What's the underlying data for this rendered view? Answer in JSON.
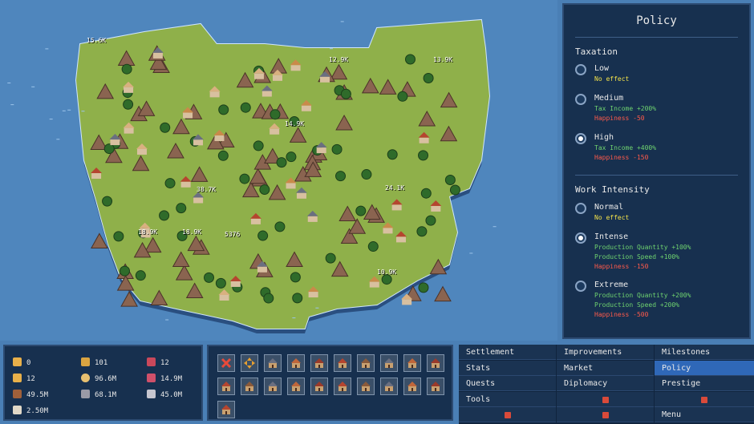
{
  "policy": {
    "title": "Policy",
    "taxation": {
      "title": "Taxation",
      "options": [
        {
          "name": "Low",
          "effects": [
            {
              "text": "No effect",
              "kind": "neutral"
            }
          ],
          "selected": false
        },
        {
          "name": "Medium",
          "effects": [
            {
              "text": "Tax Income +200%",
              "kind": "pos"
            },
            {
              "text": "Happiness -50",
              "kind": "neg"
            }
          ],
          "selected": false
        },
        {
          "name": "High",
          "effects": [
            {
              "text": "Tax Income +400%",
              "kind": "pos"
            },
            {
              "text": "Happiness -150",
              "kind": "neg"
            }
          ],
          "selected": true
        }
      ]
    },
    "work": {
      "title": "Work Intensity",
      "options": [
        {
          "name": "Normal",
          "effects": [
            {
              "text": "No effect",
              "kind": "neutral"
            }
          ],
          "selected": false
        },
        {
          "name": "Intense",
          "effects": [
            {
              "text": "Production Quantity +100%",
              "kind": "pos"
            },
            {
              "text": "Production Speed +100%",
              "kind": "pos"
            },
            {
              "text": "Happiness -150",
              "kind": "neg"
            }
          ],
          "selected": true
        },
        {
          "name": "Extreme",
          "effects": [
            {
              "text": "Production Quantity +200%",
              "kind": "pos"
            },
            {
              "text": "Production Speed +200%",
              "kind": "pos"
            },
            {
              "text": "Happiness -500",
              "kind": "neg"
            }
          ],
          "selected": false
        }
      ]
    }
  },
  "resources": [
    {
      "icon": "crown-icon",
      "value": "0",
      "color": "#e8b04a"
    },
    {
      "icon": "wheat-icon",
      "value": "101",
      "color": "#d9a441"
    },
    {
      "icon": "meat-icon",
      "value": "12",
      "color": "#c9485b"
    },
    {
      "icon": "people-icon",
      "value": "12",
      "color": "#e8b04a"
    },
    {
      "icon": "coin-icon",
      "value": "96.6M",
      "color": "#e8c070"
    },
    {
      "icon": "ore-icon",
      "value": "14.9M",
      "color": "#d0506a"
    },
    {
      "icon": "wood-icon",
      "value": "49.5M",
      "color": "#a0603a"
    },
    {
      "icon": "stone-icon",
      "value": "68.1M",
      "color": "#9a9aa6"
    },
    {
      "icon": "iron-icon",
      "value": "45.0M",
      "color": "#c6c6d0"
    },
    {
      "icon": "plank-icon",
      "value": "2.50M",
      "color": "#e0d8c8"
    }
  ],
  "build_slots": [
    "close-icon",
    "move-icon",
    "hut-icon",
    "house-icon",
    "barn-icon",
    "farm-icon",
    "mill-icon",
    "smithy-icon",
    "mine-icon",
    "field-icon",
    "tower-icon",
    "forge-icon",
    "workshop-icon",
    "lumber-icon",
    "quarry-icon",
    "storage-icon",
    "factory-icon",
    "market-icon",
    "bakery-icon",
    "tavern-icon",
    "statue-icon"
  ],
  "tabs": [
    {
      "label": "Settlement",
      "active": false,
      "locked": false
    },
    {
      "label": "Improvements",
      "active": false,
      "locked": false
    },
    {
      "label": "Milestones",
      "active": false,
      "locked": false
    },
    {
      "label": "Stats",
      "active": false,
      "locked": false
    },
    {
      "label": "Market",
      "active": false,
      "locked": false
    },
    {
      "label": "Policy",
      "active": true,
      "locked": false
    },
    {
      "label": "Quests",
      "active": false,
      "locked": false
    },
    {
      "label": "Diplomacy",
      "active": false,
      "locked": false
    },
    {
      "label": "Prestige",
      "active": false,
      "locked": false
    },
    {
      "label": "Tools",
      "active": false,
      "locked": false
    },
    {
      "label": "",
      "active": false,
      "locked": true
    },
    {
      "label": "",
      "active": false,
      "locked": true
    },
    {
      "label": "",
      "active": false,
      "locked": true
    },
    {
      "label": "",
      "active": false,
      "locked": true
    },
    {
      "label": "Menu",
      "active": false,
      "locked": false
    }
  ],
  "map_labels": [
    "15.6K",
    "12.9K",
    "13.9K",
    "14.9K",
    "38.7K",
    "24.1K",
    "18.9K",
    "18.9K",
    "5376",
    "10.9K"
  ]
}
